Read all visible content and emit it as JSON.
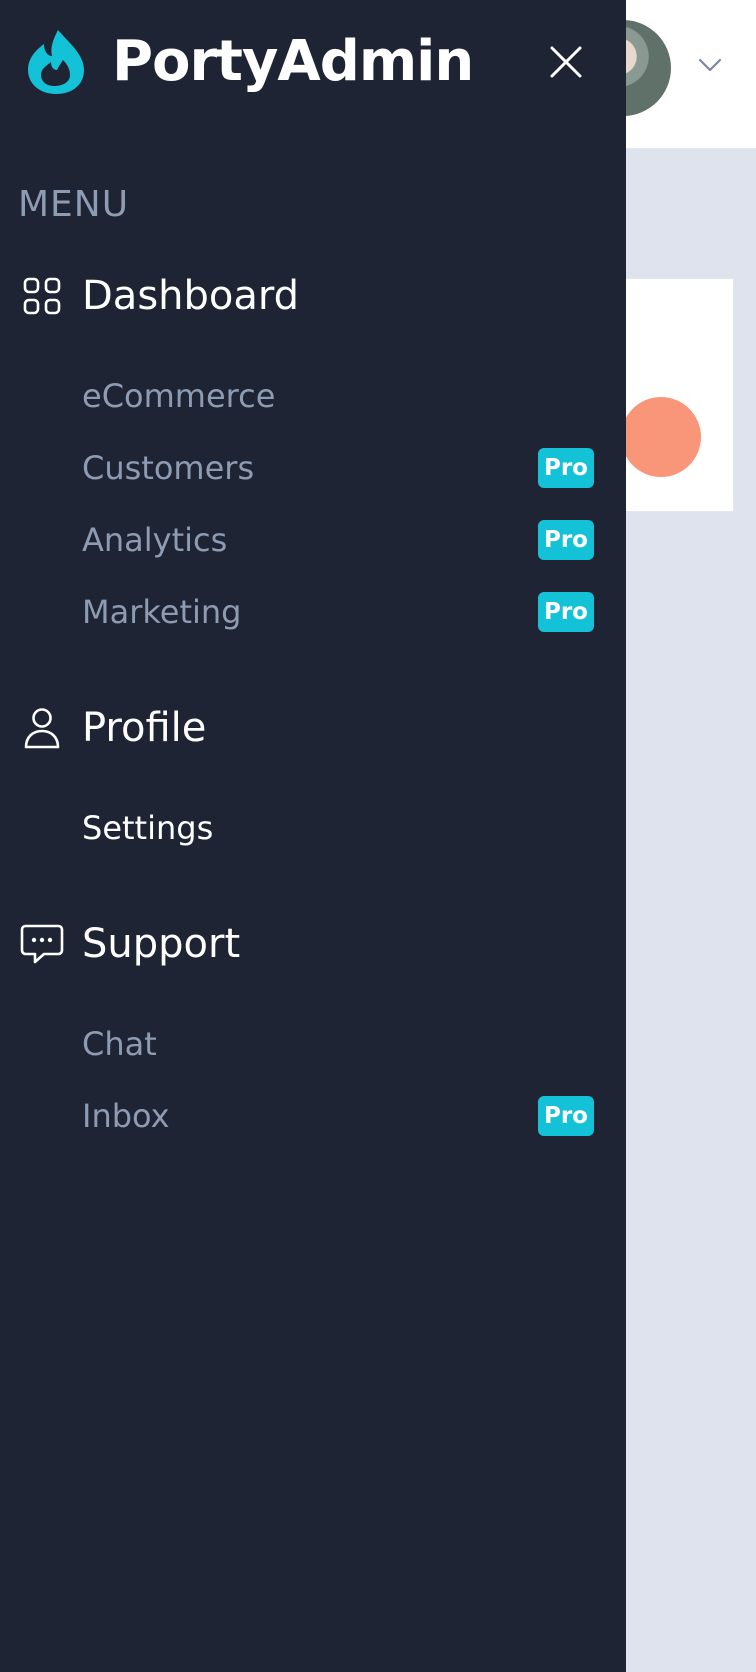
{
  "brand": {
    "name": "PortyAdmin",
    "accent": "#13c2d6"
  },
  "menu_heading": "MENU",
  "groups": [
    {
      "label": "Dashboard",
      "icon": "grid-icon",
      "items": [
        {
          "label": "eCommerce",
          "badge": ""
        },
        {
          "label": "Customers",
          "badge": "Pro"
        },
        {
          "label": "Analytics",
          "badge": "Pro"
        },
        {
          "label": "Marketing",
          "badge": "Pro"
        }
      ]
    },
    {
      "label": "Profile",
      "icon": "user-icon",
      "items": [
        {
          "label": "Settings",
          "badge": ""
        }
      ]
    },
    {
      "label": "Support",
      "icon": "chat-bubble-icon",
      "items": [
        {
          "label": "Chat",
          "badge": ""
        },
        {
          "label": "Inbox",
          "badge": "Pro"
        }
      ]
    }
  ],
  "colors": {
    "sidebar_bg": "#1e2433",
    "muted_text": "#8d9bb3",
    "badge_bg": "#13c2d6",
    "page_bg": "#dfe3ee",
    "card_accent": "#f9967a"
  }
}
